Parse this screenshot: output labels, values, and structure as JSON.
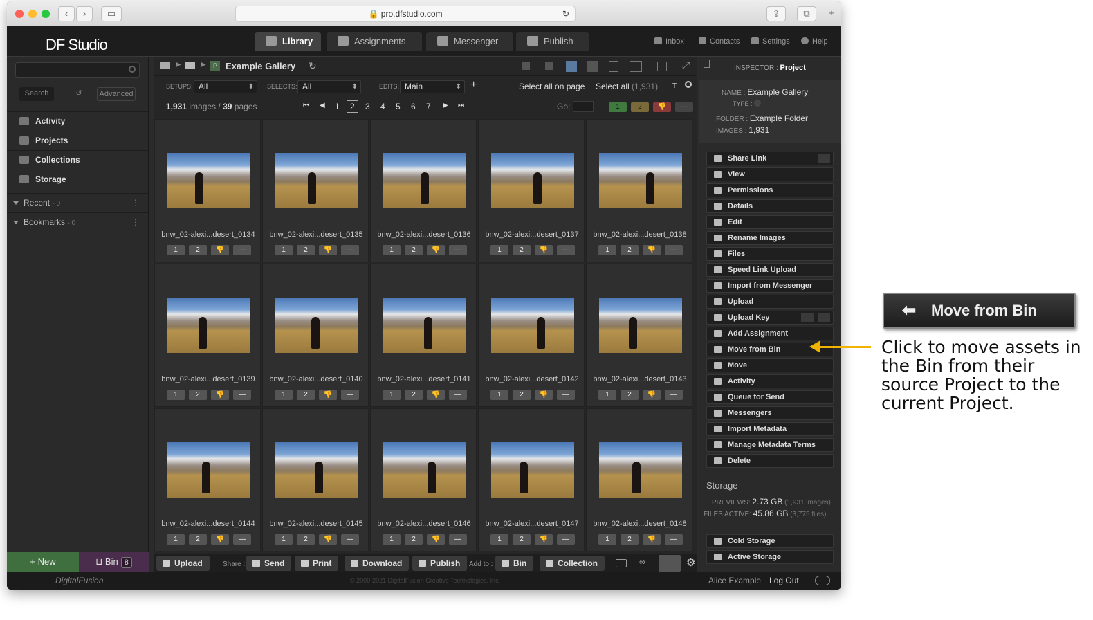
{
  "browser": {
    "url": "pro.dfstudio.com"
  },
  "app": {
    "logo": "DF Studio"
  },
  "main_tabs": [
    {
      "label": "Library",
      "icon": "library-icon",
      "active": true
    },
    {
      "label": "Assignments",
      "icon": "assignments-icon"
    },
    {
      "label": "Messenger",
      "icon": "messenger-icon"
    },
    {
      "label": "Publish",
      "icon": "publish-icon"
    }
  ],
  "header_links": {
    "inbox": "Inbox",
    "contacts": "Contacts",
    "settings": "Settings",
    "help": "Help"
  },
  "sidebar": {
    "search_btn": "Search",
    "advanced_btn": "Advanced",
    "nav": [
      {
        "label": "Activity",
        "icon": "activity-icon"
      },
      {
        "label": "Projects",
        "icon": "projects-icon"
      },
      {
        "label": "Collections",
        "icon": "collections-icon"
      },
      {
        "label": "Storage",
        "icon": "storage-icon"
      }
    ],
    "groups": [
      {
        "label": "Recent",
        "count": "- 0"
      },
      {
        "label": "Bookmarks",
        "count": "- 0"
      }
    ],
    "new_btn": "+ New",
    "bin_btn": "Bin",
    "bin_count": "8"
  },
  "breadcrumb": {
    "title": "Example Gallery"
  },
  "filters": {
    "setups_label": "SETUPS:",
    "setups_value": "All",
    "selects_label": "SELECTS:",
    "selects_value": "All",
    "edits_label": "EDITS:",
    "edits_value": "Main",
    "add": "+",
    "select_page": "Select all on page",
    "select_all": "Select all",
    "select_all_count": "(1,931)"
  },
  "pager": {
    "images": "1,931",
    "images_label": "images /",
    "pages": "39",
    "pages_label": "pages",
    "page_numbers": [
      "1",
      "2",
      "3",
      "4",
      "5",
      "6",
      "7"
    ],
    "current": "2",
    "go_label": "Go:",
    "flags": [
      "1",
      "2",
      "👎",
      "—"
    ]
  },
  "images": [
    "bnw_02-alexi...desert_0134",
    "bnw_02-alexi...desert_0135",
    "bnw_02-alexi...desert_0136",
    "bnw_02-alexi...desert_0137",
    "bnw_02-alexi...desert_0138",
    "bnw_02-alexi...desert_0139",
    "bnw_02-alexi...desert_0140",
    "bnw_02-alexi...desert_0141",
    "bnw_02-alexi...desert_0142",
    "bnw_02-alexi...desert_0143",
    "bnw_02-alexi...desert_0144",
    "bnw_02-alexi...desert_0145",
    "bnw_02-alexi...desert_0146",
    "bnw_02-alexi...desert_0147",
    "bnw_02-alexi...desert_0148"
  ],
  "rating_buttons": [
    "1",
    "2",
    "👎",
    "—"
  ],
  "toolbar": {
    "upload": "Upload",
    "share_label": "Share :",
    "send": "Send",
    "print": "Print",
    "download": "Download",
    "publish": "Publish",
    "addto_label": "Add to :",
    "bin": "Bin",
    "collection": "Collection"
  },
  "inspector": {
    "label": "INSPECTOR :",
    "title": "Project",
    "name_label": "NAME :",
    "name": "Example Gallery",
    "type_label": "TYPE :",
    "folder_label": "FOLDER :",
    "folder": "Example Folder",
    "images_label": "IMAGES :",
    "images": "1,931",
    "actions": [
      "Share Link",
      "View",
      "Permissions",
      "Details",
      "Edit",
      "Rename Images",
      "Files",
      "Speed Link Upload",
      "Import from Messenger",
      "Upload",
      "Upload Key",
      "Add Assignment",
      "Move from Bin",
      "Move",
      "Activity",
      "Queue for Send",
      "Messengers",
      "Import Metadata",
      "Manage Metadata Terms",
      "Delete"
    ],
    "storage_heading": "Storage",
    "previews_label": "PREVIEWS:",
    "previews": "2.73 GB",
    "previews_note": "(1,931 images)",
    "files_label": "FILES ACTIVE:",
    "files": "45.86 GB",
    "files_note": "(3,775 files)",
    "cold_storage": "Cold Storage",
    "active_storage": "Active Storage"
  },
  "footer": {
    "brand": "DigitalFusion",
    "copyright": "© 2000-2021 DigitalFusion Creative Technologies, Inc.",
    "user": "Alice Example",
    "logout": "Log Out"
  },
  "callout": {
    "button_label": "Move from Bin",
    "text": "Click to move assets in the Bin from their source Project to the current Project.",
    "arrow_color": "#f0b400"
  }
}
